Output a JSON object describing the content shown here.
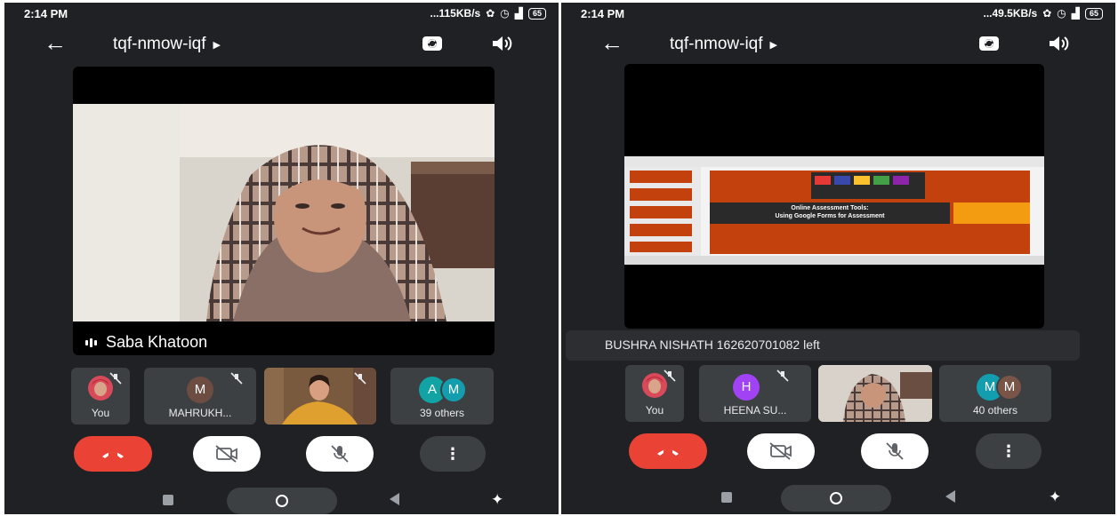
{
  "left_screen": {
    "status": {
      "time": "2:14 PM",
      "speed": "115KB/s",
      "battery": "65"
    },
    "meeting_code": "tqf-nmow-iqf",
    "speaker_name": "Saba Khatoon",
    "tiles": [
      {
        "label": "You"
      },
      {
        "label": "MAHRUKH...",
        "initial": "M"
      },
      {
        "label": ""
      },
      {
        "label": "39 others",
        "initials": [
          "A",
          "M"
        ]
      }
    ]
  },
  "right_screen": {
    "status": {
      "time": "2:14 PM",
      "speed": "49.5KB/s",
      "battery": "65"
    },
    "meeting_code": "tqf-nmow-iqf",
    "notice": "BUSHRA NISHATH 162620701082 left",
    "slide": {
      "title_line1": "Online Assessment Tools:",
      "title_line2": "Using Google Forms for Assessment"
    },
    "tiles": [
      {
        "label": "You"
      },
      {
        "label": "HEENA SU...",
        "initial": "H"
      },
      {
        "label": ""
      },
      {
        "label": "40 others",
        "initials": [
          "M",
          "M"
        ]
      }
    ]
  },
  "colors": {
    "background": "#202124",
    "tile": "#3c4043",
    "end_call": "#ea4335",
    "avatar_mahrukh": "#6d4c41",
    "avatar_heena": "#a142f4",
    "avatar_a": "#12a4a4",
    "avatar_m": "#129eaf",
    "avatar_m_brown": "#795548"
  },
  "icons": [
    "back-arrow-icon",
    "caret-right-icon",
    "switch-camera-icon",
    "speaker-icon",
    "mic-off-icon",
    "camera-off-icon",
    "more-vert-icon",
    "end-call-icon",
    "audio-level-icon",
    "accessibility-icon"
  ]
}
